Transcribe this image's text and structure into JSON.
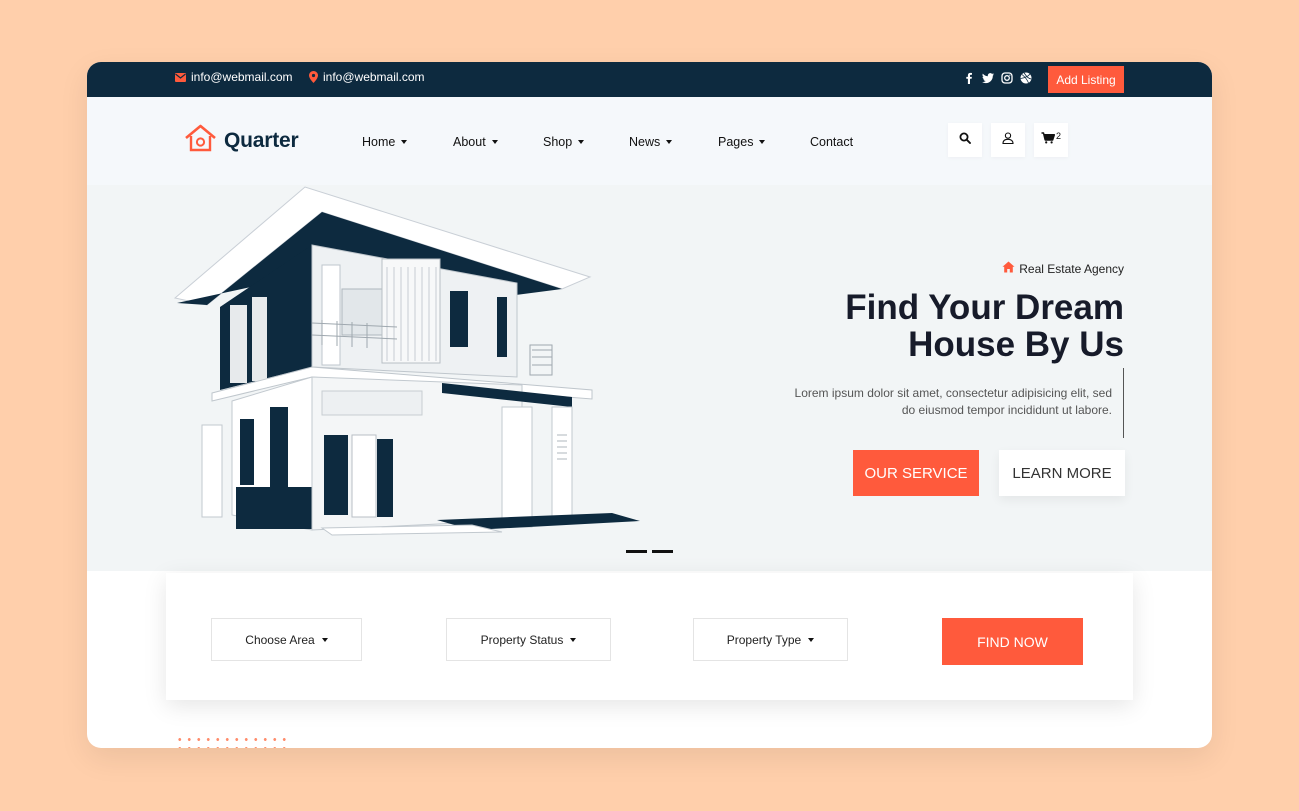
{
  "topbar": {
    "email_1": "info@webmail.com",
    "email_2": "info@webmail.com",
    "socials": [
      "facebook-icon",
      "twitter-icon",
      "instagram-icon",
      "dribbble-icon"
    ],
    "add_listing": "Add Listing"
  },
  "header": {
    "logo_text": "Quarter",
    "nav": [
      {
        "label": "Home",
        "dropdown": true
      },
      {
        "label": "About",
        "dropdown": true
      },
      {
        "label": "Shop",
        "dropdown": true
      },
      {
        "label": "News",
        "dropdown": true
      },
      {
        "label": "Pages",
        "dropdown": true
      },
      {
        "label": "Contact",
        "dropdown": false
      }
    ],
    "cart_count": "2"
  },
  "hero": {
    "tagline": "Real Estate Agency",
    "title_line1": "Find Your Dream",
    "title_line2": "House By Us",
    "description": "Lorem ipsum dolor sit amet, consectetur adipisicing elit, sed do eiusmod tempor incididunt ut labore.",
    "primary_button": "OUR SERVICE",
    "secondary_button": "LEARN MORE"
  },
  "search": {
    "area_label": "Choose Area",
    "status_label": "Property Status",
    "type_label": "Property Type",
    "find_button": "FIND NOW"
  },
  "colors": {
    "accent": "#FF5A3C",
    "dark": "#0D2A3F",
    "page_bg": "#FFCFAB"
  }
}
